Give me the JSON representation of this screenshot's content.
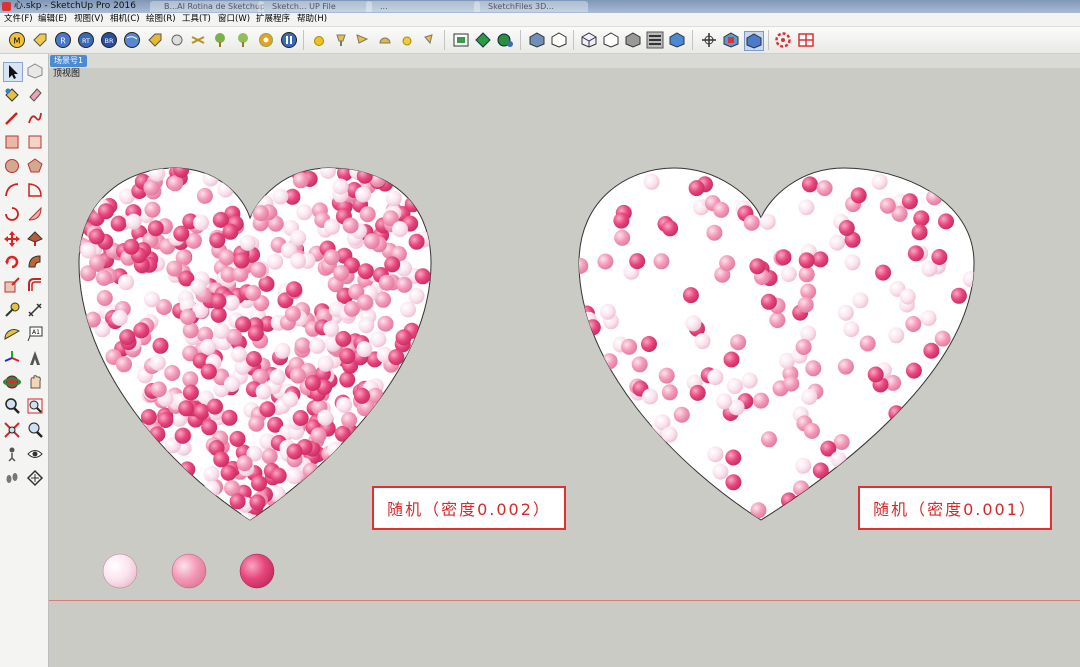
{
  "window": {
    "title": "心.skp - SketchUp Pro 2016",
    "faded_tabs": [
      "B...AI Rotina de Sketchup",
      "Sketch... UP File",
      "...",
      "SketchFiles 3D..."
    ]
  },
  "menu": [
    "文件(F)",
    "编辑(E)",
    "视图(V)",
    "相机(C)",
    "绘图(R)",
    "工具(T)",
    "窗口(W)",
    "扩展程序",
    "帮助(H)"
  ],
  "scene_tab": "场景号1",
  "view_label": "顶视图",
  "annotations": {
    "left": "随机（密度0.002）",
    "right": "随机（密度0.001）"
  },
  "colors": {
    "sphere_light": "#fbe3ee",
    "sphere_mid": "#f49ab8",
    "sphere_dark": "#e8457c",
    "viewport_bg": "#cbcbc6",
    "label_red": "#e03030"
  },
  "toolbar_icons": [
    "model-info-icon",
    "tag-icon",
    "r-icon",
    "rt-icon",
    "br-icon",
    "globe-icon",
    "tag2-icon",
    "sphere-icon",
    "scatter-icon",
    "tree-icon",
    "tree2-icon",
    "gear-icon",
    "pause-icon",
    "yellow-ball-icon",
    "lamp-icon",
    "spotlight-icon",
    "dome-icon",
    "light-icon",
    "light2-icon",
    "frame-icon",
    "green-diamond-icon",
    "green-globe-icon",
    "cube-blue-icon",
    "cube-outline-icon",
    "xray-icon",
    "hidden-line-icon",
    "shaded-icon",
    "textured-icon",
    "monochrome-icon",
    "standard-view-icon",
    "section-icon",
    "walk-icon",
    "gear-red-icon",
    "grid-red-icon"
  ],
  "left_tools": [
    "select-icon",
    "component-icon",
    "paint-bucket-icon",
    "eraser-icon",
    "pencil-icon",
    "freehand-icon",
    "rectangle-icon",
    "rotated-rect-icon",
    "circle-icon",
    "polygon-icon",
    "arc-icon",
    "pie-icon",
    "three-point-arc-icon",
    "two-point-arc-icon",
    "move-icon",
    "push-pull-icon",
    "rotate-icon",
    "follow-me-icon",
    "scale-icon",
    "offset-icon",
    "tape-measure-icon",
    "dimension-icon",
    "protractor-icon",
    "text-icon",
    "axes-icon",
    "3d-text-icon",
    "orbit-icon",
    "pan-icon",
    "zoom-icon",
    "zoom-window-icon",
    "zoom-extents-icon",
    "previous-icon",
    "position-camera-icon",
    "look-around-icon",
    "walk-footprint-icon",
    "section-plane-icon"
  ]
}
